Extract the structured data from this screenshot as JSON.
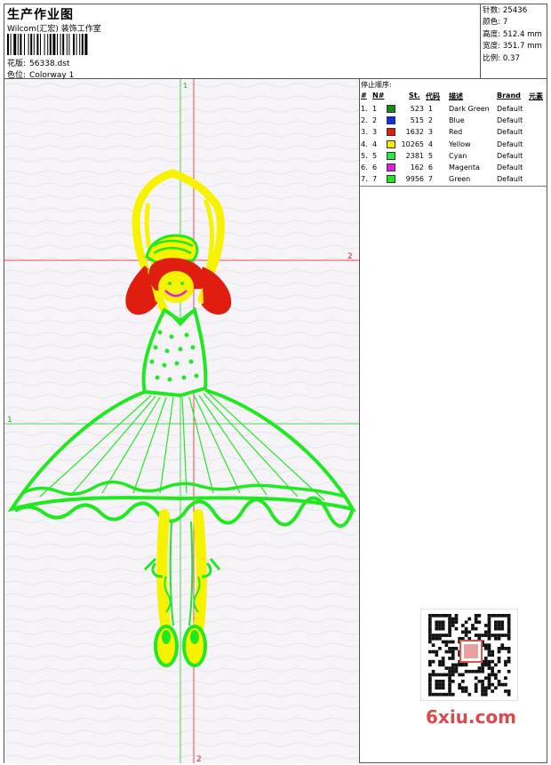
{
  "header": {
    "title": "生产作业图",
    "studio": "Wilcom(汇宏) 装饰工作室",
    "design_label": "花版:",
    "design_value": "56338.dst",
    "colorway_label": "色位:",
    "colorway_value": "Colorway 1"
  },
  "stats": [
    {
      "label": "针数:",
      "value": "25436"
    },
    {
      "label": "颜色:",
      "value": "7"
    },
    {
      "label": "高度:",
      "value": "512.4 mm"
    },
    {
      "label": "宽度:",
      "value": "351.7 mm"
    },
    {
      "label": "比例:",
      "value": "0.37"
    }
  ],
  "stop_order": {
    "title": "停止顺序:",
    "columns": {
      "num": "#",
      "n": "N#",
      "st": "St.",
      "code": "代码",
      "desc": "描述",
      "brand": "Brand",
      "elem": "元素"
    },
    "rows": [
      {
        "idx": "1.",
        "n": "1",
        "color": "#1b8a1b",
        "st": "523",
        "code": "1",
        "desc": "Dark Green",
        "brand": "Default"
      },
      {
        "idx": "2.",
        "n": "2",
        "color": "#1030e0",
        "st": "515",
        "code": "2",
        "desc": "Blue",
        "brand": "Default"
      },
      {
        "idx": "3.",
        "n": "3",
        "color": "#e01e10",
        "st": "1632",
        "code": "3",
        "desc": "Red",
        "brand": "Default"
      },
      {
        "idx": "4.",
        "n": "4",
        "color": "#f5f000",
        "st": "10265",
        "code": "4",
        "desc": "Yellow",
        "brand": "Default"
      },
      {
        "idx": "5.",
        "n": "5",
        "color": "#2ee84a",
        "st": "2381",
        "code": "5",
        "desc": "Cyan",
        "brand": "Default"
      },
      {
        "idx": "6.",
        "n": "6",
        "color": "#e020e0",
        "st": "162",
        "code": "6",
        "desc": "Magenta",
        "brand": "Default"
      },
      {
        "idx": "7.",
        "n": "7",
        "color": "#22e822",
        "st": "9956",
        "code": "7",
        "desc": "Green",
        "brand": "Default"
      }
    ]
  },
  "guides": {
    "v1": "1",
    "v2": "2",
    "h1": "1",
    "h2": "2",
    "v2_bottom": "2"
  },
  "watermark": {
    "logo": "6xiu.com"
  }
}
